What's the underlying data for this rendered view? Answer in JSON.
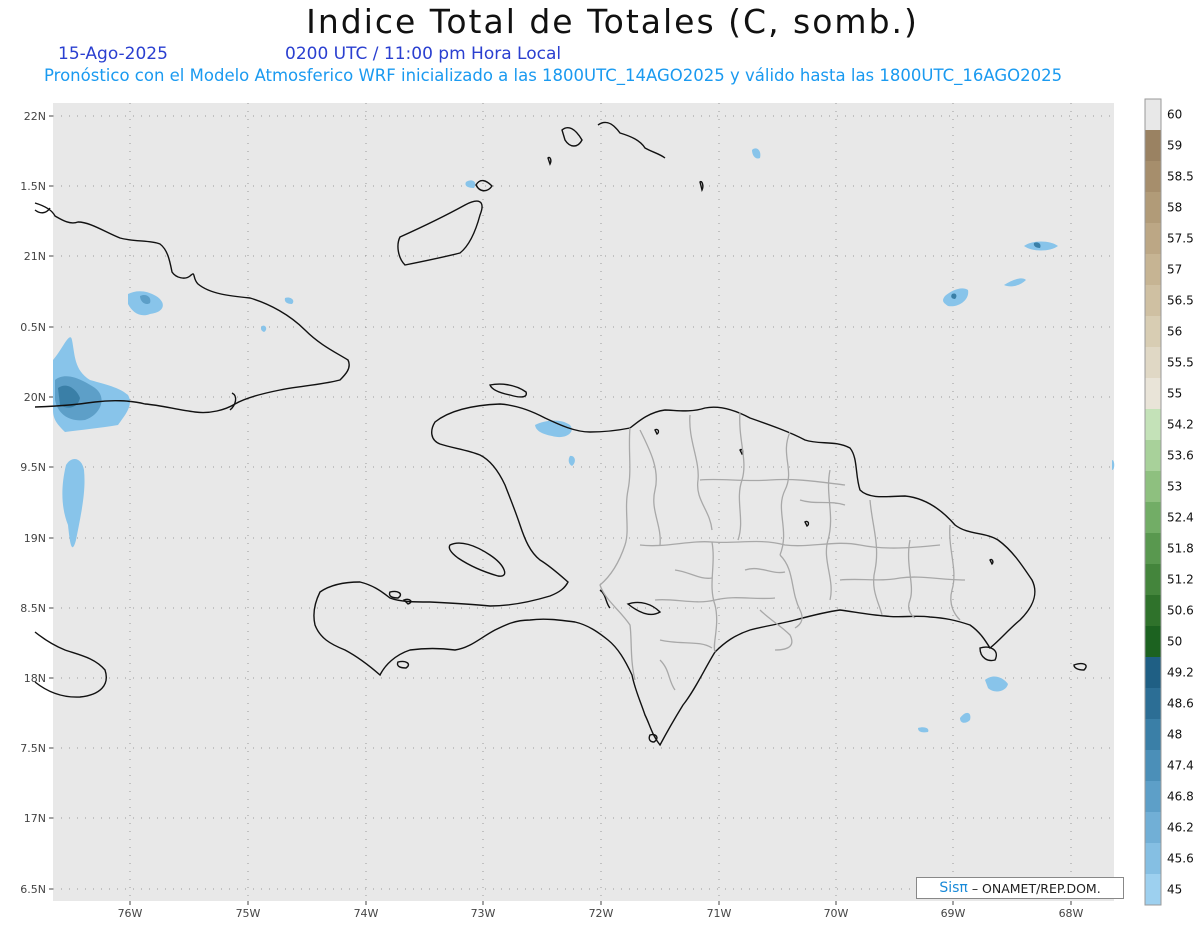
{
  "title": "Indice Total de Totales (C, somb.)",
  "date": "15-Ago-2025",
  "time_label": "0200 UTC / 11:00 pm Hora Local",
  "forecast_note": "Pronóstico con el Modelo Atmosferico WRF inicializado a las 1800UTC_14AGO2025 y válido hasta las  1800UTC_16AGO2025",
  "credit": {
    "sis": "Sisπ",
    "rest": "– ONAMET/REP.DOM."
  },
  "axes": {
    "lat_labels": [
      "22N",
      "1.5N",
      "21N",
      "0.5N",
      "20N",
      "9.5N",
      "19N",
      "8.5N",
      "18N",
      "7.5N",
      "17N",
      "6.5N"
    ],
    "lon_labels": [
      "76W",
      "75W",
      "74W",
      "73W",
      "72W",
      "71W",
      "70W",
      "69W",
      "68W"
    ]
  },
  "colorbar": {
    "labels": [
      "60",
      "59",
      "58.5",
      "58",
      "57.5",
      "57",
      "56.5",
      "56",
      "55.5",
      "55",
      "54.2",
      "53.6",
      "53",
      "52.4",
      "51.8",
      "51.2",
      "50.6",
      "50",
      "49.2",
      "48.6",
      "48",
      "47.4",
      "46.8",
      "46.2",
      "45.6",
      "45"
    ],
    "colors": [
      "#e8e8e8",
      "#9a8262",
      "#a68e6c",
      "#b19b78",
      "#bca785",
      "#c6b493",
      "#cfc0a2",
      "#d8cdb3",
      "#e0d8c5",
      "#e9e4d8",
      "#c4e2b8",
      "#a8d19a",
      "#8ec07f",
      "#72ad66",
      "#59984f",
      "#44853c",
      "#2f722b",
      "#1c6220",
      "#1f5f84",
      "#2c6e95",
      "#3a7fa7",
      "#4b8fb8",
      "#5d9fc8",
      "#71afd6",
      "#85bfe3",
      "#9dd0ef"
    ]
  },
  "map_colors": {
    "background": "#e8e8e8",
    "coast": "#111111",
    "provinces": "#a8a8a8",
    "rain_light": "#88c4ea",
    "rain_mid": "#5d9fc8",
    "rain_dark": "#3a7fa7"
  }
}
